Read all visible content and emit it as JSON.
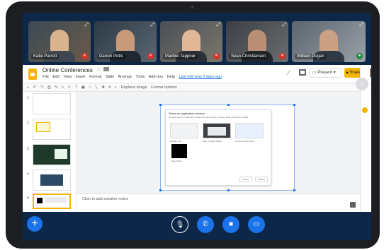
{
  "participants": [
    {
      "name": "Katie Parrott",
      "mic": "muted"
    },
    {
      "name": "Darren Potts",
      "mic": "muted"
    },
    {
      "name": "Maribel Tappner",
      "mic": "muted"
    },
    {
      "name": "Sean Christiansen",
      "mic": "muted"
    },
    {
      "name": "William Dugan",
      "mic": "active"
    }
  ],
  "slides_app": {
    "title": "Online Conferences",
    "menu": [
      "File",
      "Edit",
      "View",
      "Insert",
      "Format",
      "Slide",
      "Arrange",
      "Tools",
      "Add-ons",
      "Help"
    ],
    "last_edit": "Last edit was 3 days ago",
    "present_label": "Present",
    "share_label": "Share",
    "toolbar_items": [
      "Replace image",
      "Format options"
    ],
    "slide_numbers": [
      "1",
      "2",
      "3",
      "4",
      "5"
    ],
    "dialog": {
      "title": "Share an application window",
      "subtitle": "Chrome wants to share the contents of your screen. Choose what you'd like to share.",
      "options": [
        "Display Doll",
        "Talk - Google Slides",
        "Online Conferences",
        "Google",
        "Meet Zoom"
      ],
      "share_button": "Share",
      "cancel_button": "Cancel"
    },
    "speaker_notes": "Click to add speaker notes"
  },
  "colors": {
    "accent": "#1a73e8",
    "brand_yellow": "#f4b400",
    "call_bg": "#0d2748"
  },
  "callbar": {
    "add_icon": "plus-icon",
    "buttons": [
      "mic-off-icon",
      "phone-icon",
      "video-icon",
      "screen-share-icon"
    ]
  }
}
